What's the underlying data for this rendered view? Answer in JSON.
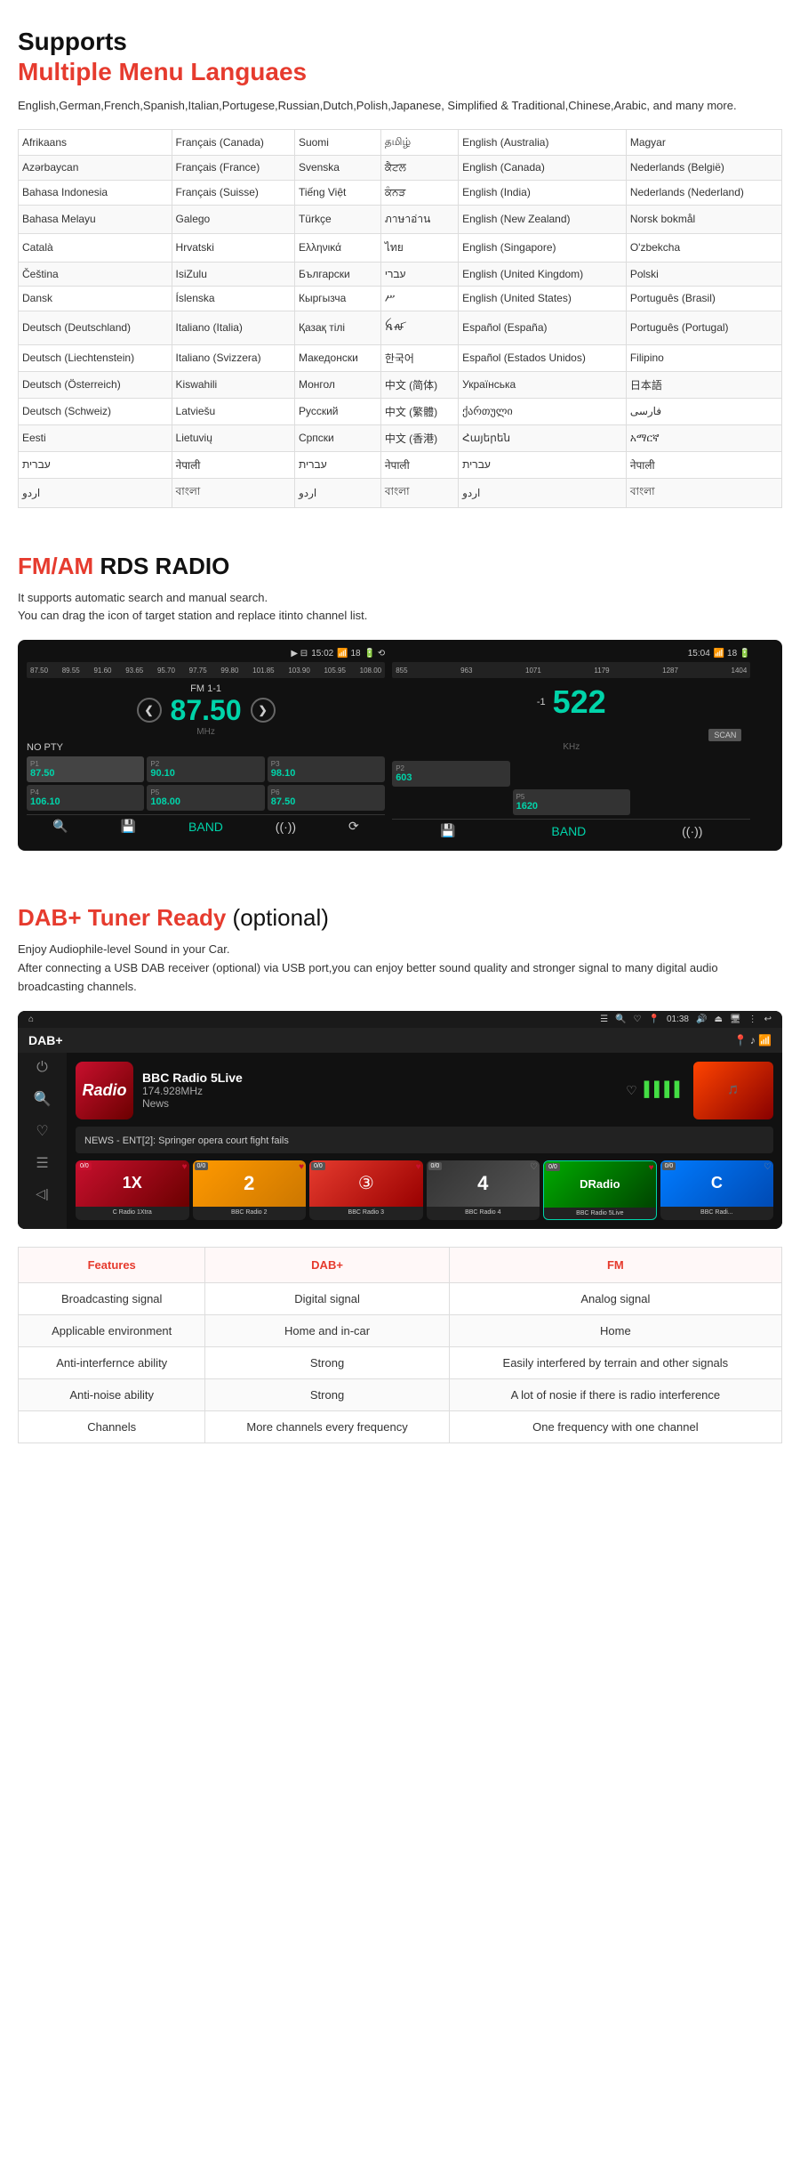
{
  "languages_section": {
    "title_black": "Supports",
    "title_red": "Multiple Menu Languaes",
    "description": "English,German,French,Spanish,Italian,Portugese,Russian,Dutch,Polish,Japanese, Simplified & Traditional,Chinese,Arabic, and many more.",
    "table_cols": [
      "col1",
      "col2",
      "col3",
      "col4",
      "col5",
      "col6"
    ],
    "rows": [
      [
        "Afrikaans",
        "Français (Canada)",
        "Suomi",
        "தமிழ்",
        "English (Australia)",
        "Magyar"
      ],
      [
        "Azərbaycan",
        "Français (France)",
        "Svenska",
        "ਕੈਟਲ",
        "English (Canada)",
        "Nederlands (België)"
      ],
      [
        "Bahasa Indonesia",
        "Français (Suisse)",
        "Tiếng Việt",
        "ਕੰਨੜ",
        "English (India)",
        "Nederlands (Nederland)"
      ],
      [
        "Bahasa Melayu",
        "Galego",
        "Türkçe",
        "ภาษาอ่าน",
        "English (New Zealand)",
        "Norsk bokmål"
      ],
      [
        "Català",
        "Hrvatski",
        "Ελληνικά",
        "ไทย",
        "English (Singapore)",
        "O'zbekcha"
      ],
      [
        "Čeština",
        "IsiZulu",
        "Български",
        "עברי",
        "English (United Kingdom)",
        "Polski"
      ],
      [
        "Dansk",
        "Íslenska",
        "Кыргызча",
        "ሥ",
        "English (United States)",
        "Português (Brasil)"
      ],
      [
        "Deutsch (Deutschland)",
        "Italiano (Italia)",
        "Қазақ тілі",
        "ꫝꫛ",
        "Español (España)",
        "Português (Portugal)"
      ],
      [
        "Deutsch (Liechtenstein)",
        "Italiano (Svizzera)",
        "Македонски",
        "한국어",
        "Español (Estados Unidos)",
        "Filipino"
      ],
      [
        "Deutsch (Österreich)",
        "Kiswahili",
        "Монгол",
        "中文 (简体)",
        "Українська",
        "日本語"
      ],
      [
        "Deutsch (Schweiz)",
        "Latviešu",
        "Русский",
        "中文 (繁體)",
        "ქართული",
        "فارسی"
      ],
      [
        "Eesti",
        "Lietuvių",
        "Српски",
        "中文 (香港)",
        "Հայերեն",
        "አማርኛ"
      ],
      [
        "עברית",
        "नेपाली",
        "עברית",
        "नेपाली",
        "עברית",
        "नेपाली"
      ],
      [
        "اردو",
        "বাংলা",
        "اردو",
        "বাংলা",
        "اردو",
        "বাংলা"
      ]
    ]
  },
  "fmam_section": {
    "title_red": "FM/AM",
    "title_black": "RDS RADIO",
    "description_line1": "It supports automatic search and manual search.",
    "description_line2": "You can drag the icon of target station and replace itinto channel list.",
    "left_screen": {
      "time": "15:02",
      "band_label": "FM 1-1",
      "frequency": "87.50",
      "unit": "MHz",
      "pty": "NO PTY",
      "freq_range_start": "87.50",
      "freq_range_end": "108.00",
      "freq_marks": [
        "87.50",
        "89.55",
        "91.60",
        "93.65",
        "95.70",
        "97.75",
        "99.80",
        "101.85",
        "103.90",
        "105.95",
        "108.00"
      ],
      "presets": [
        {
          "num": "P1",
          "freq": "87.50",
          "active": true
        },
        {
          "num": "P2",
          "freq": "90.10"
        },
        {
          "num": "P3",
          "freq": "98.10"
        },
        {
          "num": "P4",
          "freq": "106.10"
        },
        {
          "num": "P5",
          "freq": "108.00"
        },
        {
          "num": "P6",
          "freq": "87.50"
        }
      ]
    },
    "right_screen": {
      "time": "15:04",
      "frequency": "522",
      "unit": "KHz",
      "freq_marks": [
        "855",
        "963",
        "1071",
        "1179",
        "1287",
        "1404"
      ],
      "scan_label": "SCAN",
      "presets": [
        {
          "num": "P2",
          "freq": "603"
        },
        {
          "num": "P5",
          "freq": "1620"
        }
      ]
    }
  },
  "dab_section": {
    "title_red": "DAB+ Tuner Ready",
    "title_optional": "(optional)",
    "desc_line1": "Enjoy Audiophile-level Sound in your Car.",
    "desc_line2": "After connecting a USB DAB receiver (optional) via USB port,you can enjoy better sound quality and stronger signal to many digital audio broadcasting channels.",
    "screenshot": {
      "status_time": "01:38",
      "top_title": "DAB+",
      "station_name": "BBC Radio 5Live",
      "station_freq": "174.928MHz",
      "station_type": "News",
      "now_playing": "NEWS - ENT[2]: Springer opera court fight fails",
      "channels": [
        {
          "badge": "0/0",
          "name": "C Radio 1Xtra",
          "color": "dab-ch-1"
        },
        {
          "badge": "0/0",
          "name": "BBC Radio 2",
          "color": "dab-ch-2"
        },
        {
          "badge": "0/0",
          "name": "BBC Radio 3",
          "color": "dab-ch-3"
        },
        {
          "badge": "0/0",
          "name": "BBC Radio 4",
          "color": "dab-ch-4"
        },
        {
          "badge": "0/0",
          "name": "BBC Radio 5Live",
          "color": "dab-ch-5"
        },
        {
          "badge": "0/0",
          "name": "BBC Radi...",
          "color": "dab-ch-6"
        }
      ]
    }
  },
  "comparison": {
    "headers": {
      "features": "Features",
      "dab": "DAB+",
      "fm": "FM"
    },
    "rows": [
      {
        "feature": "Broadcasting signal",
        "dab": "Digital signal",
        "fm": "Analog signal"
      },
      {
        "feature": "Applicable environment",
        "dab": "Home and in-car",
        "fm": "Home"
      },
      {
        "feature": "Anti-interfernce ability",
        "dab": "Strong",
        "fm": "Easily interfered by terrain and other signals"
      },
      {
        "feature": "Anti-noise ability",
        "dab": "Strong",
        "fm": "A lot of nosie if there is radio interference"
      },
      {
        "feature": "Channels",
        "dab": "More channels every frequency",
        "fm": "One frequency with one channel"
      }
    ]
  }
}
